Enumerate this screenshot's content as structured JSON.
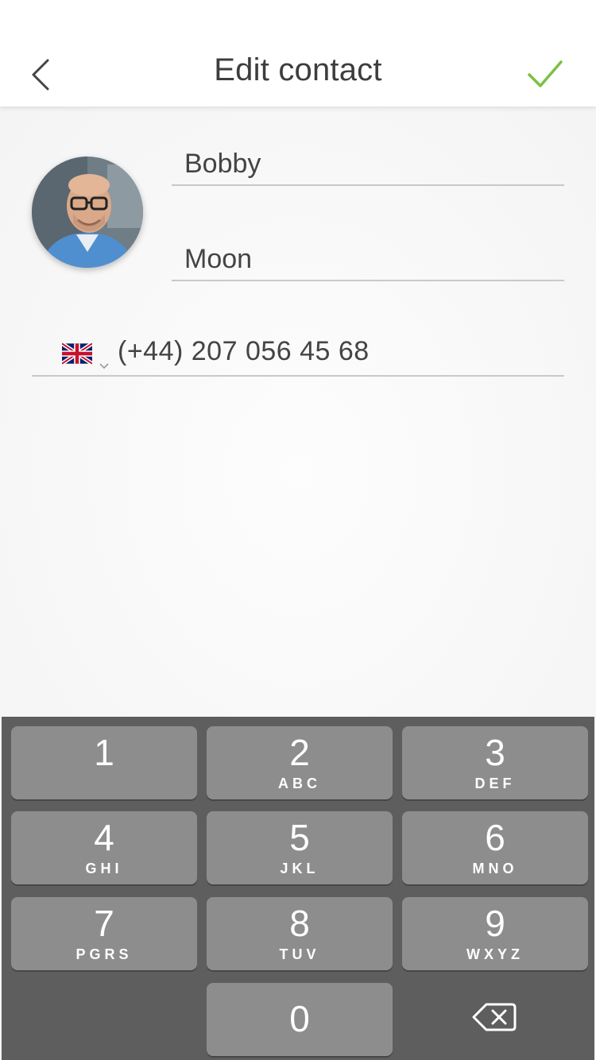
{
  "header": {
    "title": "Edit contact",
    "back_icon": "chevron-left-icon",
    "confirm_icon": "checkmark-icon",
    "confirm_color": "#7ac143"
  },
  "contact": {
    "first_name": "Bobby",
    "last_name": "Moon",
    "country_flag": "uk-flag-icon",
    "phone": "(+44) 207  056 45 68"
  },
  "keypad": {
    "keys": [
      {
        "num": "1",
        "letters": ""
      },
      {
        "num": "2",
        "letters": "ABC"
      },
      {
        "num": "3",
        "letters": "DEF"
      },
      {
        "num": "4",
        "letters": "GHI"
      },
      {
        "num": "5",
        "letters": "JKL"
      },
      {
        "num": "6",
        "letters": "MNO"
      },
      {
        "num": "7",
        "letters": "PGRS"
      },
      {
        "num": "8",
        "letters": "TUV"
      },
      {
        "num": "9",
        "letters": "WXYZ"
      },
      {
        "num": "0",
        "letters": ""
      }
    ],
    "backspace_icon": "backspace-icon"
  }
}
